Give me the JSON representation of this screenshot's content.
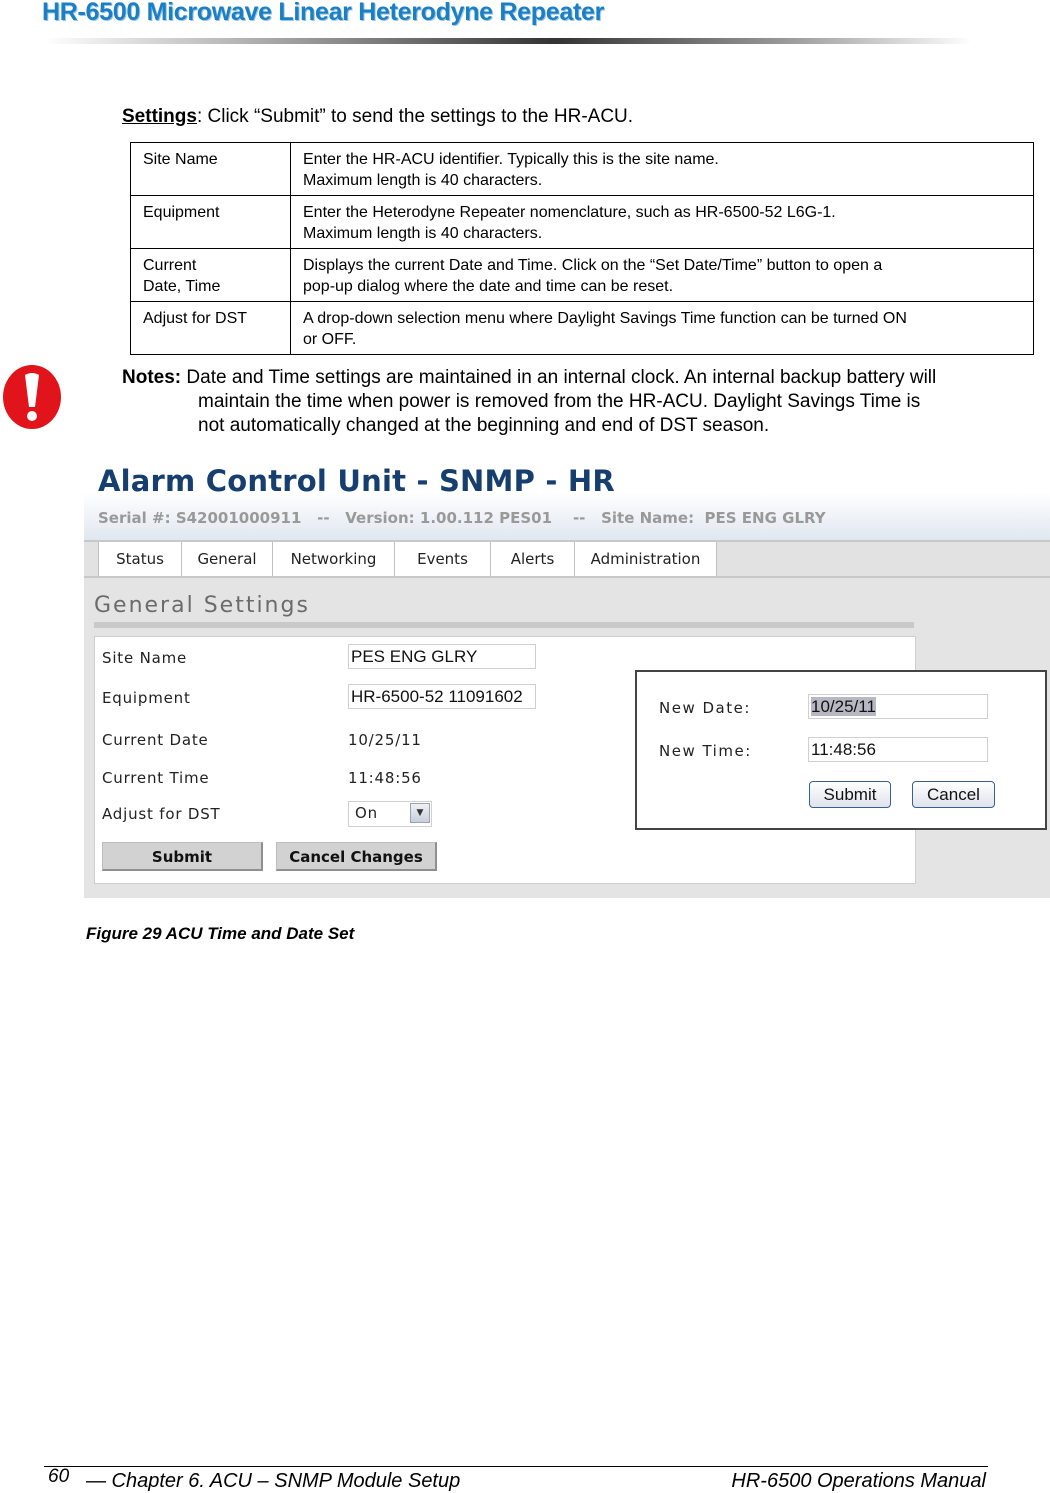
{
  "header": {
    "title": "HR-6500 Microwave Linear Heterodyne Repeater"
  },
  "settings_intro": {
    "label": "Settings",
    "text": ": Click “Submit” to send the settings to the HR-ACU."
  },
  "settings_table": {
    "rows": [
      {
        "key": "Site Name",
        "lines": [
          "Enter the HR-ACU identifier. Typically this is the site name.",
          "Maximum length is 40 characters."
        ]
      },
      {
        "key": "Equipment",
        "lines": [
          "Enter the Heterodyne Repeater nomenclature, such as HR-6500-52 L6G-1.",
          "Maximum length is 40 characters."
        ]
      },
      {
        "key_lines": [
          "Current",
          "Date, Time"
        ],
        "lines": [
          "Displays the current Date and Time. Click on the “Set Date/Time” button to open a",
          "pop-up dialog where the date and time can be reset."
        ]
      },
      {
        "key": "Adjust for DST",
        "lines": [
          "A drop-down selection menu where Daylight Savings Time function can be turned ON",
          "or OFF."
        ]
      }
    ]
  },
  "notes": {
    "icon": "exclamation-warning-icon",
    "label": "Notes:",
    "line1": " Date and Time settings are maintained in an internal clock. An internal backup battery will",
    "line2": "maintain the time when power is removed from the HR-ACU. Daylight Savings Time is",
    "line3": "not automatically changed at the beginning and end of DST season."
  },
  "screenshot": {
    "app_title": "Alarm Control Unit - SNMP - HR",
    "meta": {
      "serial_label": "Serial #:",
      "serial": "S42001000911",
      "sep": "--",
      "version_label": "Version:",
      "version": "1.00.112 PES01",
      "site_label": "Site Name:",
      "site": "PES ENG GLRY"
    },
    "tabs": [
      "Status",
      "General",
      "Networking",
      "Events",
      "Alerts",
      "Administration"
    ],
    "section_title": "General Settings",
    "form": {
      "site_name_label": "Site Name",
      "site_name_value": "PES ENG GLRY",
      "equipment_label": "Equipment",
      "equipment_value": "HR-6500-52 11091602",
      "current_date_label": "Current Date",
      "current_date_value": "10/25/11",
      "current_time_label": "Current Time",
      "current_time_value": "11:48:56",
      "dst_label": "Adjust for DST",
      "dst_value": "On",
      "submit_label": "Submit",
      "cancel_label": "Cancel Changes"
    },
    "dialog": {
      "new_date_label": "New Date:",
      "new_date_value": "10/25/11",
      "new_time_label": "New Time:",
      "new_time_value": "11:48:56",
      "submit_label": "Submit",
      "cancel_label": "Cancel"
    }
  },
  "caption": "Figure 29  ACU Time and Date Set",
  "footer": {
    "page_number": "60",
    "chapter": "— Chapter 6. ACU – SNMP Module Setup",
    "manual": "HR-6500 Operations Manual"
  },
  "colors": {
    "title_blue": "#1a7fc4",
    "app_title_navy": "#163e6e",
    "warning_red": "#e0141a"
  }
}
